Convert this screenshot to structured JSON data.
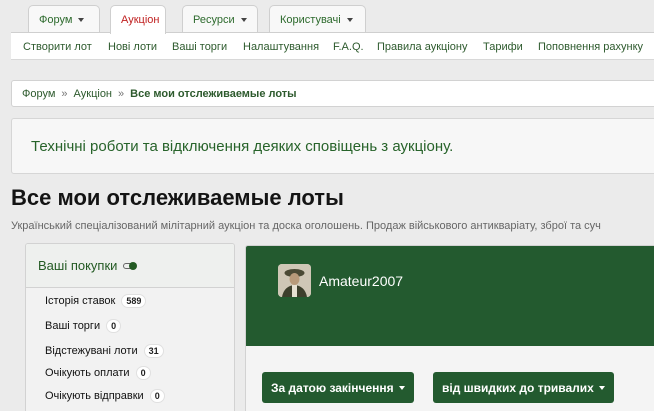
{
  "top_tabs": [
    {
      "label": "Форум",
      "dropdown": true,
      "active": false
    },
    {
      "label": "Аукціон",
      "dropdown": false,
      "active": true
    },
    {
      "label": "Ресурси",
      "dropdown": true,
      "active": false
    },
    {
      "label": "Користувачі",
      "dropdown": true,
      "active": false
    }
  ],
  "subnav": [
    "Створити лот",
    "Нові лоти",
    "Ваші торги",
    "Налаштування",
    "F.A.Q.",
    "Правила аукціону",
    "Тарифи",
    "Поповнення рахунку"
  ],
  "breadcrumb": {
    "items": [
      "Форум",
      "Аукціон"
    ],
    "separator": "»",
    "current": "Все мои отслеживаемые лоты"
  },
  "notice": "Технічні роботи та відключення деяких сповіщень з аукціону.",
  "page": {
    "title": "Все мои отслеживаемые лоты",
    "description": "Український спеціалізований мілітарний аукціон та доска оголошень. Продаж військового антикваріату, зброї та суч"
  },
  "sidebar": {
    "heading": "Ваші покупки",
    "items": [
      {
        "label": "Історія ставок",
        "count": "589"
      },
      {
        "label": "Ваші торги",
        "count": "0"
      },
      {
        "label": "Відстежувані лоти",
        "count": "31"
      },
      {
        "label": "Очікують оплати",
        "count": "0"
      },
      {
        "label": "Очікують відправки",
        "count": "0"
      }
    ]
  },
  "profile": {
    "username": "Amateur2007"
  },
  "sort": {
    "by_label": "За датою закінчення",
    "order_label": "від швидких до тривалих"
  },
  "colors": {
    "accent": "#235a2f",
    "active_tab": "#c02020",
    "link": "#2d6a2d"
  }
}
